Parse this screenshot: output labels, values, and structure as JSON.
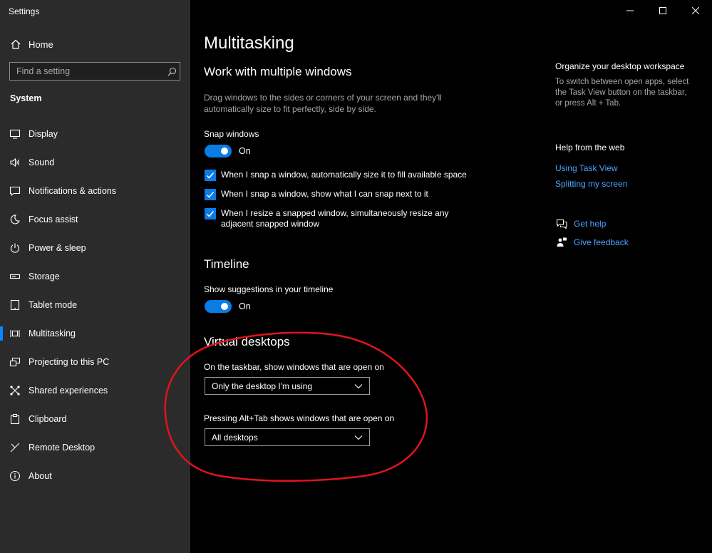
{
  "window": {
    "title": "Settings"
  },
  "sidebar": {
    "home_label": "Home",
    "search_placeholder": "Find a setting",
    "section": "System",
    "items": [
      {
        "label": "Display",
        "icon": "monitor-icon"
      },
      {
        "label": "Sound",
        "icon": "speaker-icon"
      },
      {
        "label": "Notifications & actions",
        "icon": "notification-icon"
      },
      {
        "label": "Focus assist",
        "icon": "moon-icon"
      },
      {
        "label": "Power & sleep",
        "icon": "power-icon"
      },
      {
        "label": "Storage",
        "icon": "storage-icon"
      },
      {
        "label": "Tablet mode",
        "icon": "tablet-icon"
      },
      {
        "label": "Multitasking",
        "icon": "multitasking-icon",
        "active": true
      },
      {
        "label": "Projecting to this PC",
        "icon": "projector-icon"
      },
      {
        "label": "Shared experiences",
        "icon": "shared-experiences-icon"
      },
      {
        "label": "Clipboard",
        "icon": "clipboard-icon"
      },
      {
        "label": "Remote Desktop",
        "icon": "remote-desktop-icon"
      },
      {
        "label": "About",
        "icon": "info-icon"
      }
    ]
  },
  "main": {
    "title": "Multitasking",
    "work_section": {
      "heading": "Work with multiple windows",
      "description": "Drag windows to the sides or corners of your screen and they'll automatically size to fit perfectly, side by side.",
      "snap_label": "Snap windows",
      "snap_state": "On",
      "checkboxes": [
        "When I snap a window, automatically size it to fill available space",
        "When I snap a window, show what I can snap next to it",
        "When I resize a snapped window, simultaneously resize any adjacent snapped window"
      ]
    },
    "timeline_section": {
      "heading": "Timeline",
      "label": "Show suggestions in your timeline",
      "state": "On"
    },
    "virtual_desktops": {
      "heading": "Virtual desktops",
      "taskbar_label": "On the taskbar, show windows that are open on",
      "taskbar_value": "Only the desktop I'm using",
      "alttab_label": "Pressing Alt+Tab shows windows that are open on",
      "alttab_value": "All desktops"
    }
  },
  "right_panel": {
    "organize_heading": "Organize your desktop workspace",
    "organize_text": "To switch between open apps, select the Task View button on the taskbar, or press Alt + Tab.",
    "help_heading": "Help from the web",
    "links": [
      "Using Task View",
      "Splitting my screen"
    ],
    "get_help": "Get help",
    "give_feedback": "Give feedback"
  },
  "colors": {
    "accent": "#0a7ce6",
    "annotation": "#e0141e",
    "sidebar_bg": "#2b2b2b"
  }
}
